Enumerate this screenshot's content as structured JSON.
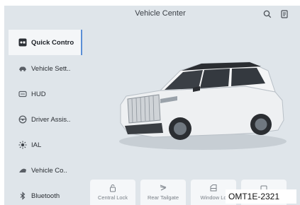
{
  "header": {
    "title": "Vehicle Center",
    "icons": {
      "search": "search-icon",
      "menu": "document-menu-icon"
    }
  },
  "sidebar": {
    "items": [
      {
        "label": "Quick Contro",
        "icon": "quick-control-icon",
        "active": true
      },
      {
        "label": "Vehicle Sett..",
        "icon": "car-icon",
        "active": false
      },
      {
        "label": "HUD",
        "icon": "hud-icon",
        "active": false
      },
      {
        "label": "Driver Assis..",
        "icon": "steering-wheel-icon",
        "active": false
      },
      {
        "label": "IAL",
        "icon": "light-icon",
        "active": false
      },
      {
        "label": "Vehicle Co..",
        "icon": "wiper-icon",
        "active": false
      },
      {
        "label": "Bluetooth",
        "icon": "bluetooth-icon",
        "active": false
      }
    ]
  },
  "controls": [
    {
      "label": "Central Lock",
      "icon": "lock-icon"
    },
    {
      "label": "Rear Tailgate",
      "icon": "tailgate-icon"
    },
    {
      "label": "Window Lo",
      "icon": "window-icon"
    },
    {
      "label": "",
      "icon": "more-icon"
    }
  ],
  "figure_code": "OMT1E-2321",
  "colors": {
    "screen_bg": "#dfe5ea",
    "active_item_bg": "#f4f6f8",
    "active_indicator": "#5b8fd6",
    "card_bg": "#f5f7f9"
  }
}
